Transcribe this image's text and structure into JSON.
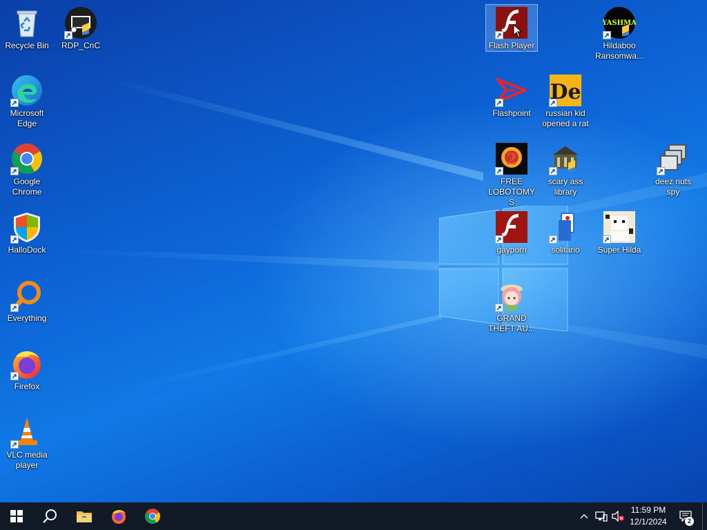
{
  "desktop": {
    "icons": [
      {
        "label": "Recycle Bin"
      },
      {
        "label": "RDP_CnC"
      },
      {
        "label": "Microsoft Edge"
      },
      {
        "label": "Google Chrome"
      },
      {
        "label": "HalloDock"
      },
      {
        "label": "Everything"
      },
      {
        "label": "Firefox"
      },
      {
        "label": "VLC media player"
      },
      {
        "label": "Flash Player"
      },
      {
        "label": "Hildaboo Ransomwa..."
      },
      {
        "label": "Flashpoint"
      },
      {
        "label": "russian kid opened a rat"
      },
      {
        "label": "FREE LOBOTOMYS"
      },
      {
        "label": "scary ass library"
      },
      {
        "label": "deez nuts spy"
      },
      {
        "label": "gayporn"
      },
      {
        "label": "solitario"
      },
      {
        "label": "Super Hilda"
      },
      {
        "label": "GRAND THEFT AU..."
      }
    ],
    "logo_texts": {
      "yashma": "YASHMA",
      "de": "De"
    }
  },
  "taskbar": {
    "clock_time": "11:59 PM",
    "clock_date": "12/1/2024",
    "notification_count": "2"
  },
  "colors": {
    "taskbar": "#111a26",
    "desktop_accent": "#0d63d6"
  }
}
